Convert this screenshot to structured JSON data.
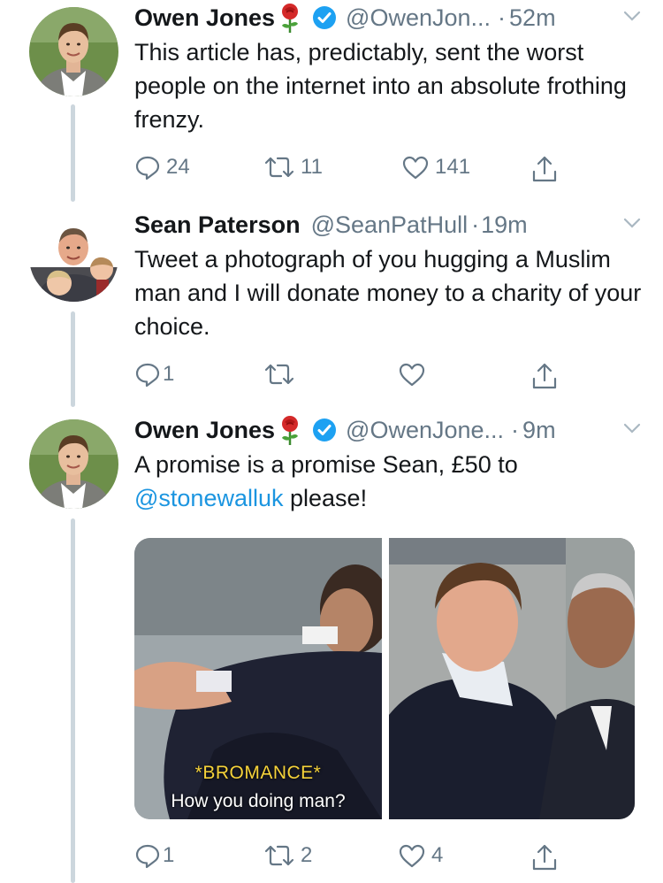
{
  "tweets": [
    {
      "name": "Owen Jones",
      "handle": "@OwenJon...",
      "time": "52m",
      "text": "This article has, predictably, sent the worst people on the internet into an absolute frothing frenzy.",
      "replies": "24",
      "retweets": "11",
      "likes": "141"
    },
    {
      "name": "Sean Paterson",
      "handle": "@SeanPatHull",
      "time": "19m",
      "text": "Tweet a photograph of you hugging a Muslim man and I will donate money to a charity of your choice.",
      "replies": "1",
      "retweets": "",
      "likes": ""
    },
    {
      "name": "Owen Jones",
      "handle": "@OwenJone...",
      "time": "9m",
      "text_before": "A promise is a promise Sean, £50 to",
      "mention": "@stonewalluk",
      "text_after": " please!",
      "replies": "1",
      "retweets": "2",
      "likes": "4",
      "media": {
        "caption_top": "*BROMANCE*",
        "caption_bottom": "How you doing man?"
      }
    }
  ],
  "colors": {
    "text": "#14171a",
    "secondary": "#657786",
    "link": "#1b95e0",
    "verified": "#1da1f2",
    "thread_line": "#ccd6dd"
  },
  "icons": [
    "rose-icon",
    "verified-icon",
    "chevron-down-icon",
    "reply-icon",
    "retweet-icon",
    "like-icon",
    "share-icon"
  ]
}
